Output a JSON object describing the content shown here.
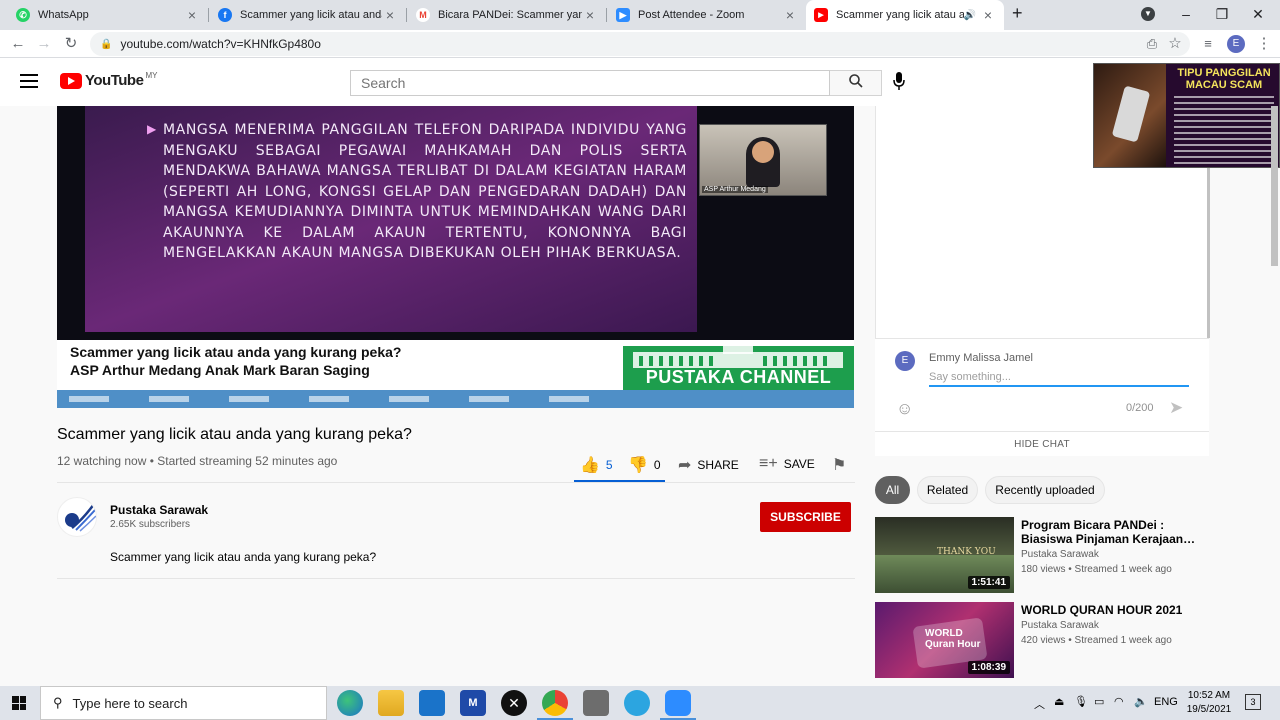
{
  "browser": {
    "tabs": [
      {
        "title": "WhatsApp",
        "icon": "whatsapp-icon",
        "color": "#25d366"
      },
      {
        "title": "Scammer yang licik atau anda ya",
        "icon": "facebook-icon",
        "color": "#1877f2"
      },
      {
        "title": "Bicara PANDei: Scammer yang lic",
        "icon": "gmail-icon",
        "color": "#ea4335"
      },
      {
        "title": "Post Attendee - Zoom",
        "icon": "zoom-icon",
        "color": "#2d8cff"
      },
      {
        "title": "Scammer yang licik atau and",
        "icon": "youtube-icon",
        "color": "#ff0000",
        "active": true
      }
    ],
    "url": "youtube.com/watch?v=KHNfkGp480o",
    "profile_initial": "E"
  },
  "youtube": {
    "logo_text": "YouTube",
    "country_code": "MY",
    "search_placeholder": "Search"
  },
  "video": {
    "slide_text": "MANGSA MENERIMA PANGGILAN TELEFON DARIPADA INDIVIDU YANG MENGAKU SEBAGAI PEGAWAI MAHKAMAH DAN POLIS SERTA MENDAKWA BAHAWA MANGSA TERLIBAT DI DALAM KEGIATAN HARAM (SEPERTI AH LONG, KONGSI GELAP DAN PENGEDARAN DADAH) DAN MANGSA KEMUDIANNYA DIMINTA UNTUK MEMINDAHKAN WANG DARI AKAUNNYA KE DALAM AKAUN TERTENTU, KONONNYA BAGI MENGELAKKAN AKAUN MANGSA DIBEKUKAN OLEH PIHAK BERKUASA.",
    "cam_label": "ASP Arthur Medang",
    "lower_third_line1": "Scammer yang licik atau anda yang kurang peka?",
    "lower_third_line2": "ASP Arthur Medang Anak Mark Baran Saging",
    "channel_brand": "PUSTAKA CHANNEL",
    "title": "Scammer yang licik atau anda yang kurang peka?",
    "meta": "12 watching now • Started streaming 52 minutes ago",
    "likes": "5",
    "dislikes": "0",
    "share_label": "SHARE",
    "save_label": "SAVE"
  },
  "channel": {
    "name": "Pustaka Sarawak",
    "subscribers": "2.65K subscribers",
    "subscribe_label": "SUBSCRIBE",
    "description": "Scammer yang licik atau anda yang kurang peka?"
  },
  "chat": {
    "user_name": "Emmy Malissa Jamel",
    "user_initial": "E",
    "placeholder": "Say something...",
    "counter": "0/200",
    "hide_label": "HIDE CHAT"
  },
  "pip": {
    "title_line1": "TIPU PANGGILAN",
    "title_line2": "MACAU SCAM"
  },
  "chips": [
    "All",
    "Related",
    "Recently uploaded"
  ],
  "related": [
    {
      "title": "Program Bicara PANDei : Biasiswa Pinjaman Kerajaan…",
      "channel": "Pustaka Sarawak",
      "meta": "180 views • Streamed 1 week ago",
      "duration": "1:51:41",
      "thumb_text": "THANK YOU"
    },
    {
      "title": "WORLD QURAN HOUR 2021",
      "channel": "Pustaka Sarawak",
      "meta": "420 views • Streamed 1 week ago",
      "duration": "1:08:39",
      "thumb_text": "WORLD Quran Hour"
    }
  ],
  "taskbar": {
    "search_placeholder": "Type here to search",
    "language": "ENG",
    "time": "10:52 AM",
    "date": "19/5/2021",
    "notification_count": "3"
  }
}
